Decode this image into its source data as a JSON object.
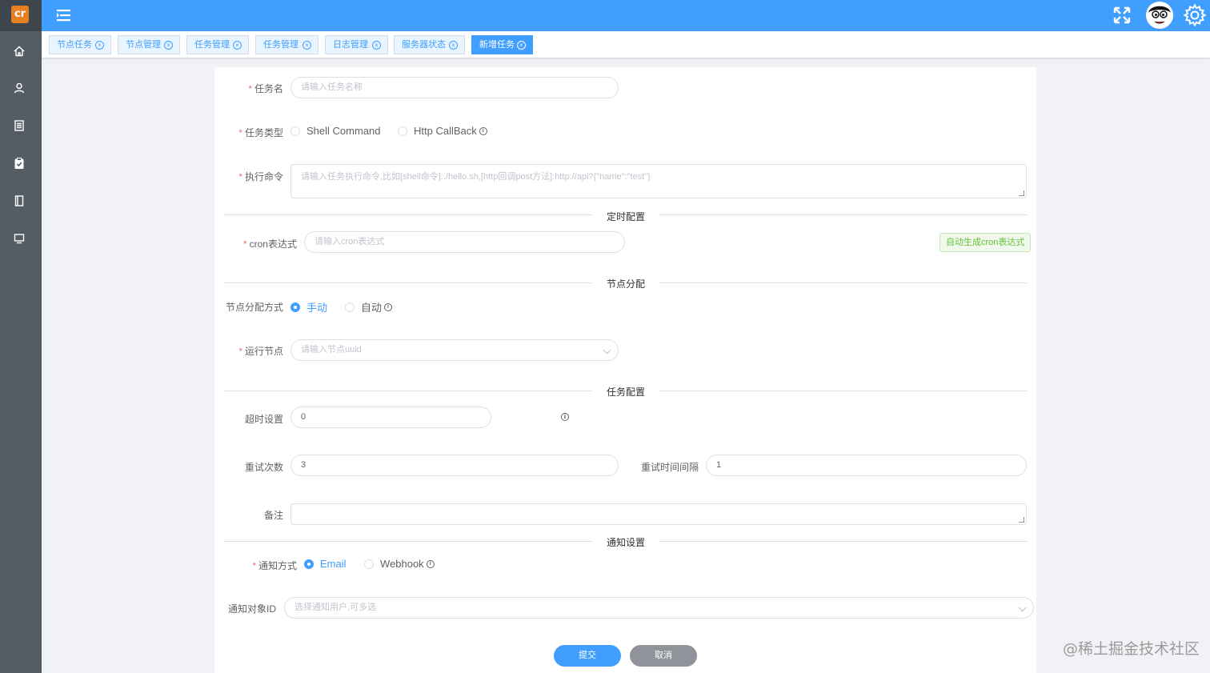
{
  "app": {
    "logo_text": "cr"
  },
  "sidebar": {
    "items": [
      {
        "icon": "home-icon"
      },
      {
        "icon": "user-icon"
      },
      {
        "icon": "list-icon"
      },
      {
        "icon": "clipboard-check-icon"
      },
      {
        "icon": "book-icon"
      },
      {
        "icon": "monitor-icon"
      }
    ]
  },
  "header": {
    "menu_icon": "menu-toggle-icon",
    "fullscreen_icon": "fullscreen-icon",
    "settings_icon": "gear-icon"
  },
  "tabs": [
    {
      "label": "节点任务",
      "active": false
    },
    {
      "label": "节点管理",
      "active": false
    },
    {
      "label": "任务管理",
      "active": false
    },
    {
      "label": "任务管理",
      "active": false
    },
    {
      "label": "日志管理",
      "active": false
    },
    {
      "label": "服务器状态",
      "active": false
    },
    {
      "label": "新增任务",
      "active": true
    }
  ],
  "form": {
    "task_name": {
      "label": "任务名",
      "placeholder": "请输入任务名称"
    },
    "task_type": {
      "label": "任务类型",
      "options": [
        "Shell Command",
        "Http CallBack"
      ]
    },
    "command": {
      "label": "执行命令",
      "placeholder": "请输入任务执行命令,比如[shell命令]:./hello.sh,[http回调post方法]:http://api?{\"name\":\"test\"}"
    },
    "section_schedule": "定时配置",
    "cron": {
      "label": "cron表达式",
      "placeholder": "请输入cron表达式",
      "auto_button": "自动生成cron表达式"
    },
    "section_node": "节点分配",
    "node_mode": {
      "label": "节点分配方式",
      "options": [
        "手动",
        "自动"
      ],
      "selected": "手动"
    },
    "run_node": {
      "label": "运行节点",
      "placeholder": "请输入节点uuid"
    },
    "section_task": "任务配置",
    "timeout": {
      "label": "超时设置",
      "value": "0"
    },
    "retry_count": {
      "label": "重试次数",
      "value": "3"
    },
    "retry_interval": {
      "label": "重试时间间隔",
      "value": "1"
    },
    "remark": {
      "label": "备注",
      "value": ""
    },
    "section_notify": "通知设置",
    "notify_method": {
      "label": "通知方式",
      "options": [
        "Email",
        "Webhook"
      ],
      "selected": "Email"
    },
    "notify_target": {
      "label": "通知对象ID",
      "placeholder": "选择通知用户,可多选"
    },
    "submit_label": "提交",
    "cancel_label": "取消"
  },
  "colors": {
    "primary": "#409eff",
    "sidebar": "#545c64",
    "success": "#67c23a",
    "danger": "#f56c6c"
  },
  "watermark": "@稀土掘金技术社区"
}
